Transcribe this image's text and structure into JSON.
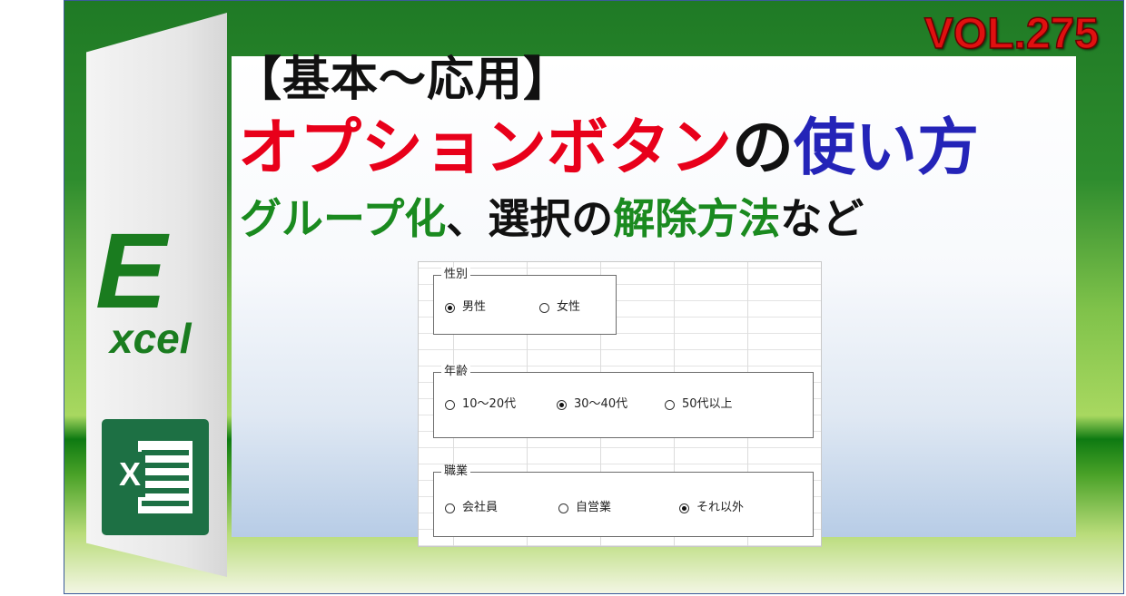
{
  "volume": "VOL.275",
  "title_line1": "【基本～応用】",
  "title_line2": {
    "part1": "オプションボタン",
    "part2": "の",
    "part3": "使い方"
  },
  "title_line3": {
    "part1": "グループ化",
    "part2": "、選択の",
    "part3": "解除方法",
    "part4": "など"
  },
  "logo": {
    "letter": "E",
    "rest": "xcel",
    "badge": "X"
  },
  "groups": {
    "gender": {
      "title": "性別",
      "options": [
        {
          "label": "男性",
          "selected": true
        },
        {
          "label": "女性",
          "selected": false
        }
      ]
    },
    "age": {
      "title": "年齢",
      "options": [
        {
          "label": "10～20代",
          "selected": false
        },
        {
          "label": "30～40代",
          "selected": true
        },
        {
          "label": "50代以上",
          "selected": false
        }
      ]
    },
    "job": {
      "title": "職業",
      "options": [
        {
          "label": "会社員",
          "selected": false
        },
        {
          "label": "自営業",
          "selected": false
        },
        {
          "label": "それ以外",
          "selected": true
        }
      ]
    }
  },
  "colors": {
    "red": "#e8001a",
    "green": "#1a8a1f",
    "blue": "#2424b8",
    "excel_green": "#1d7044"
  }
}
